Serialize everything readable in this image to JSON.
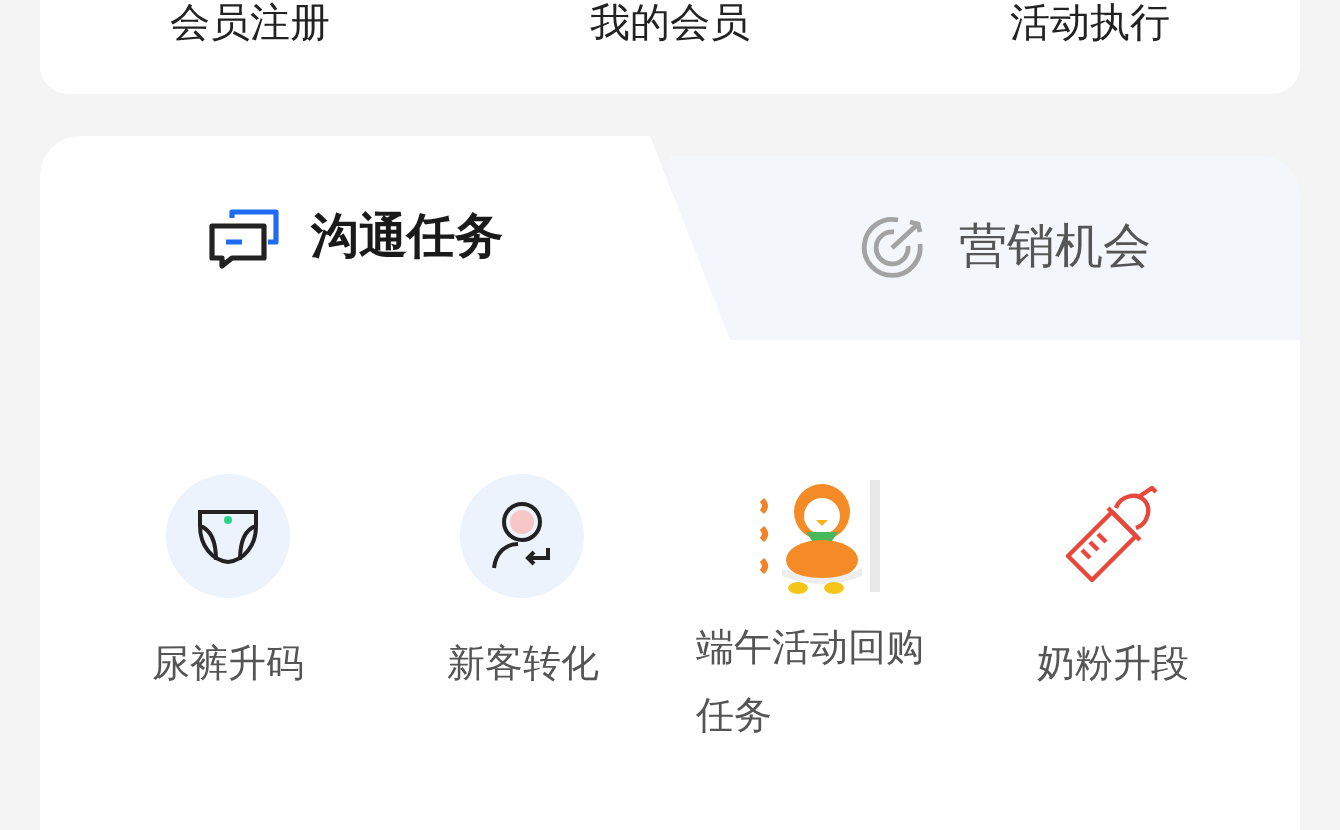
{
  "top_menu": [
    {
      "label": "会员注册"
    },
    {
      "label": "我的会员"
    },
    {
      "label": "活动执行"
    }
  ],
  "tabs": [
    {
      "label": "沟通任务",
      "selected": true
    },
    {
      "label": "营销机会",
      "selected": false
    }
  ],
  "tasks": [
    {
      "label": "尿裤升码",
      "kind": "diaper"
    },
    {
      "label": "新客转化",
      "kind": "person"
    },
    {
      "label": "端午活动回购任务",
      "kind": "illustration"
    },
    {
      "label": "奶粉升段",
      "kind": "bottle"
    }
  ]
}
